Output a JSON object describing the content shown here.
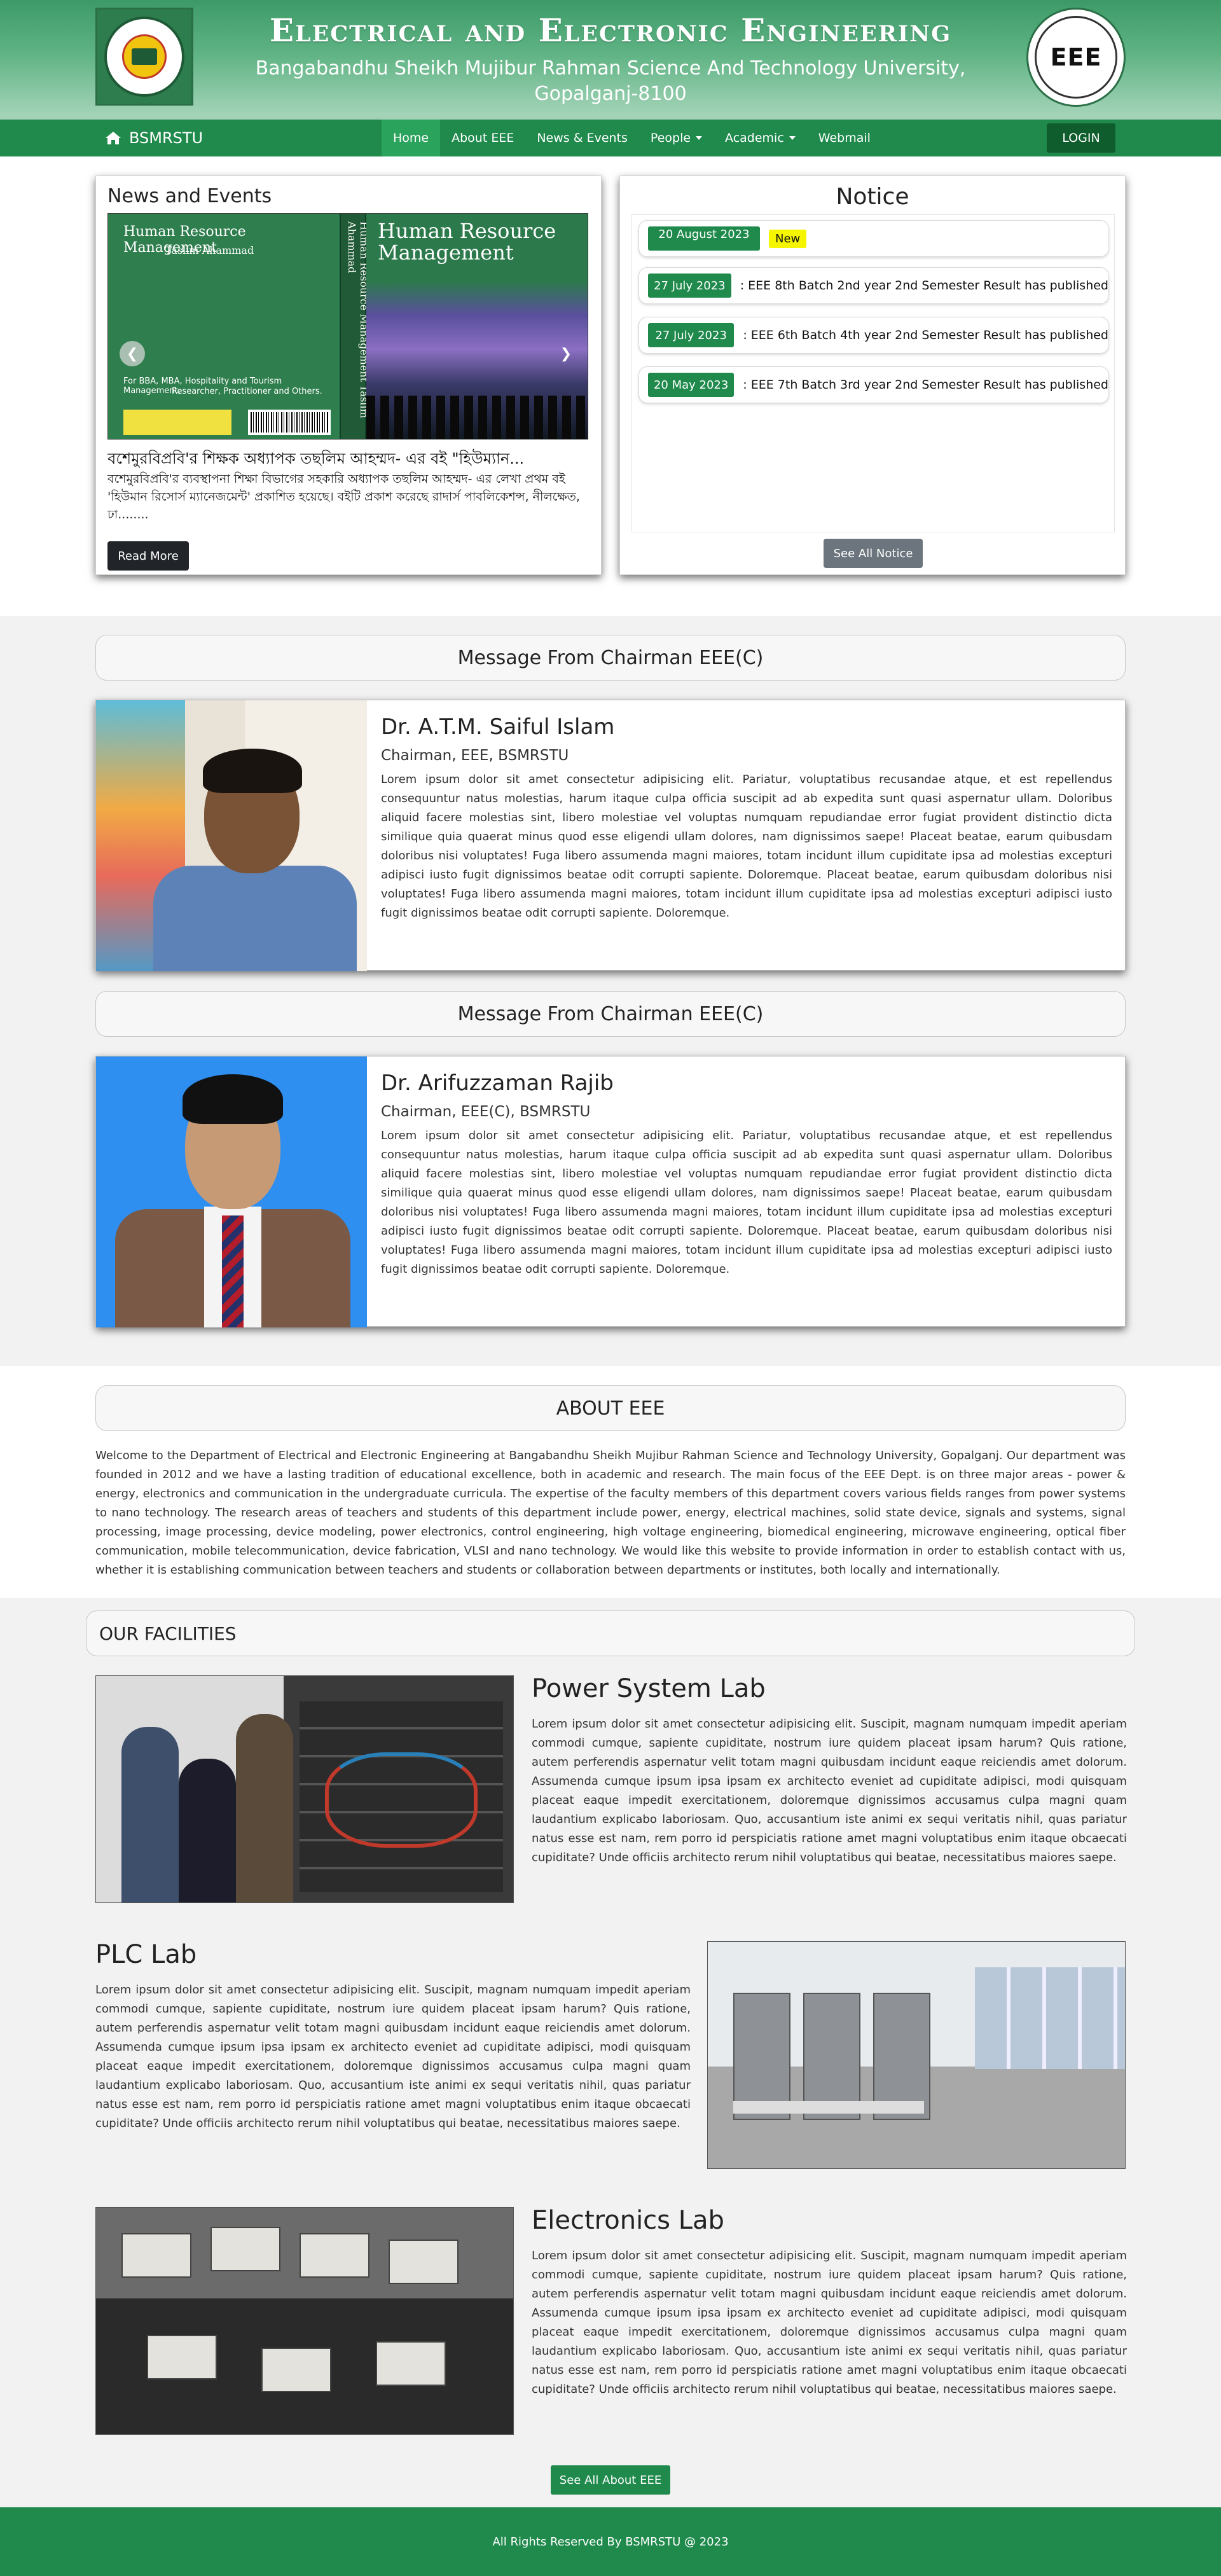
{
  "header": {
    "dept_title": "Electrical and Electronic Engineering",
    "uni_line1": "Bangabandhu Sheikh Mujibur Rahman Science And Technology University,",
    "uni_line2": "Gopalganj-8100",
    "right_logo_text": "EEE",
    "left_logo_icon": "university-seal-icon"
  },
  "navbar": {
    "brand": "BSMRSTU",
    "brand_icon": "home-icon",
    "items": [
      {
        "label": "Home",
        "active": true,
        "dropdown": false
      },
      {
        "label": "About EEE",
        "active": false,
        "dropdown": false
      },
      {
        "label": "News & Events",
        "active": false,
        "dropdown": false
      },
      {
        "label": "People",
        "active": false,
        "dropdown": true
      },
      {
        "label": "Academic",
        "active": false,
        "dropdown": true
      },
      {
        "label": "Webmail",
        "active": false,
        "dropdown": false
      }
    ],
    "login": "LOGIN"
  },
  "news": {
    "title": "News and Events",
    "book_back_title": "Human Resource Management",
    "book_back_author": "Taslim Ahammad",
    "book_back_audience1": "For BBA, MBA, Hospitality and Tourism Management,",
    "book_back_audience2": "Researcher, Practitioner and Others.",
    "book_spine": "Human Resource Management    Taslim Ahammad",
    "book_front_title": "Human Resource Management",
    "headline": "বশেমুরবিপ্রবি'র শিক্ষক অধ্যাপক তছলিম আহম্মদ- এর বই \"হিউম্যান...",
    "excerpt": "বশেমুরবিপ্রবি'র ব্যবস্থাপনা শিক্ষা বিভাগের সহকারি অধ্যাপক তছলিম আহম্মদ- এর লেখা প্রথম বই 'হিউমান রিসোর্স ম্যানেজমেন্ট' প্রকাশিত হয়েছে। বইটি প্রকাশ করেছে রাদার্স পাবলিকেশন্স, নীলক্ষেত, ঢা........",
    "read_more": "Read More",
    "prev_icon": "chevron-left-icon",
    "next_icon": "chevron-right-icon"
  },
  "notice": {
    "title": "Notice",
    "items": [
      {
        "date": "20 August 2023",
        "text": "",
        "badge": "New"
      },
      {
        "date": "27 July 2023",
        "text": ": EEE 8th Batch 2nd year 2nd Semester Result has published",
        "badge": ""
      },
      {
        "date": "27 July 2023",
        "text": ": EEE 6th Batch 4th year 2nd Semester Result has published",
        "badge": ""
      },
      {
        "date": "20 May 2023",
        "text": ": EEE 7th Batch 3rd year 2nd Semester Result has published",
        "badge": ""
      }
    ],
    "see_all": "See All Notice"
  },
  "messages": [
    {
      "section_title": "Message From Chairman EEE(C)",
      "name": "Dr. A.T.M. Saiful Islam",
      "role": "Chairman, EEE, BSMRSTU",
      "text": "Lorem ipsum dolor sit amet consectetur adipisicing elit. Pariatur, voluptatibus recusandae atque, et est repellendus consequuntur natus molestias, harum itaque culpa officia suscipit ad ab expedita sunt quasi aspernatur ullam. Doloribus aliquid facere molestias sint, libero molestiae vel voluptas numquam repudiandae error fugiat provident distinctio dicta similique quia quaerat minus quod esse eligendi ullam dolores, nam dignissimos saepe! Placeat beatae, earum quibusdam doloribus nisi voluptates! Fuga libero assumenda magni maiores, totam incidunt illum cupiditate ipsa ad molestias excepturi adipisci iusto fugit dignissimos beatae odit corrupti sapiente. Doloremque. Placeat beatae, earum quibusdam doloribus nisi voluptates! Fuga libero assumenda magni maiores, totam incidunt illum cupiditate ipsa ad molestias excepturi adipisci iusto fugit dignissimos beatae odit corrupti sapiente. Doloremque."
    },
    {
      "section_title": "Message From Chairman EEE(C)",
      "name": "Dr. Arifuzzaman Rajib",
      "role": "Chairman, EEE(C), BSMRSTU",
      "text": "Lorem ipsum dolor sit amet consectetur adipisicing elit. Pariatur, voluptatibus recusandae atque, et est repellendus consequuntur natus molestias, harum itaque culpa officia suscipit ad ab expedita sunt quasi aspernatur ullam. Doloribus aliquid facere molestias sint, libero molestiae vel voluptas numquam repudiandae error fugiat provident distinctio dicta similique quia quaerat minus quod esse eligendi ullam dolores, nam dignissimos saepe! Placeat beatae, earum quibusdam doloribus nisi voluptates! Fuga libero assumenda magni maiores, totam incidunt illum cupiditate ipsa ad molestias excepturi adipisci iusto fugit dignissimos beatae odit corrupti sapiente. Doloremque. Placeat beatae, earum quibusdam doloribus nisi voluptates! Fuga libero assumenda magni maiores, totam incidunt illum cupiditate ipsa ad molestias excepturi adipisci iusto fugit dignissimos beatae odit corrupti sapiente. Doloremque."
    }
  ],
  "about": {
    "title": "ABOUT EEE",
    "text": "Welcome to the Department of Electrical and Electronic Engineering at Bangabandhu Sheikh Mujibur Rahman Science and Technology University, Gopalganj. Our department was founded in 2012 and we have a lasting tradition of educational excellence, both in academic and research. The main focus of the EEE Dept. is on three major areas - power & energy, electronics and communication in the undergraduate curricula. The expertise of the faculty members of this department covers various fields ranges from power systems to nano technology. The research areas of teachers and students of this department include power, energy, electrical machines, solid state device, signals and systems, signal processing, image processing, device modeling, power electronics, control engineering, high voltage engineering, biomedical engineering, microwave engineering, optical fiber communication, mobile telecommunication, device fabrication, VLSI and nano technology. We would like this website to provide information in order to establish contact with us, whether it is establishing communication between teachers and students or collaboration between departments or institutes, both locally and internationally."
  },
  "facilities": {
    "title": "OUR FACILITIES",
    "labs": [
      {
        "name": "Power System Lab",
        "text": "Lorem ipsum dolor sit amet consectetur adipisicing elit. Suscipit, magnam numquam impedit aperiam commodi cumque, sapiente cupiditate, nostrum iure quidem placeat ipsam harum? Quis ratione, autem perferendis aspernatur velit totam magni quibusdam incidunt eaque reiciendis amet dolorum. Assumenda cumque ipsum ipsa ipsam ex architecto eveniet ad cupiditate adipisci, modi quisquam placeat eaque impedit exercitationem, doloremque dignissimos accusamus culpa magni quam laudantium explicabo laboriosam. Quo, accusantium iste animi ex sequi veritatis nihil, quas pariatur natus esse est nam, rem porro id perspiciatis ratione amet magni voluptatibus enim itaque obcaecati cupiditate? Unde officiis architecto rerum nihil voluptatibus qui beatae, necessitatibus maiores saepe."
      },
      {
        "name": "PLC Lab",
        "text": "Lorem ipsum dolor sit amet consectetur adipisicing elit. Suscipit, magnam numquam impedit aperiam commodi cumque, sapiente cupiditate, nostrum iure quidem placeat ipsam harum? Quis ratione, autem perferendis aspernatur velit totam magni quibusdam incidunt eaque reiciendis amet dolorum. Assumenda cumque ipsum ipsa ipsam ex architecto eveniet ad cupiditate adipisci, modi quisquam placeat eaque impedit exercitationem, doloremque dignissimos accusamus culpa magni quam laudantium explicabo laboriosam. Quo, accusantium iste animi ex sequi veritatis nihil, quas pariatur natus esse est nam, rem porro id perspiciatis ratione amet magni voluptatibus enim itaque obcaecati cupiditate? Unde officiis architecto rerum nihil voluptatibus qui beatae, necessitatibus maiores saepe."
      },
      {
        "name": "Electronics Lab",
        "text": "Lorem ipsum dolor sit amet consectetur adipisicing elit. Suscipit, magnam numquam impedit aperiam commodi cumque, sapiente cupiditate, nostrum iure quidem placeat ipsam harum? Quis ratione, autem perferendis aspernatur velit totam magni quibusdam incidunt eaque reiciendis amet dolorum. Assumenda cumque ipsum ipsa ipsam ex architecto eveniet ad cupiditate adipisci, modi quisquam placeat eaque impedit exercitationem, doloremque dignissimos accusamus culpa magni quam laudantium explicabo laboriosam. Quo, accusantium iste animi ex sequi veritatis nihil, quas pariatur natus esse est nam, rem porro id perspiciatis ratione amet magni voluptatibus enim itaque obcaecati cupiditate? Unde officiis architecto rerum nihil voluptatibus qui beatae, necessitatibus maiores saepe."
      }
    ],
    "see_all": "See All About EEE"
  },
  "footer": {
    "text": "All Rights Reserved By BSMRSTU @ 2023"
  },
  "colors": {
    "primary_green": "#1f8a4c",
    "active_nav": "#2aa35c",
    "login_bg": "#0f5c2c",
    "new_badge": "#f5f500",
    "section_gray": "#f2f2f2"
  }
}
